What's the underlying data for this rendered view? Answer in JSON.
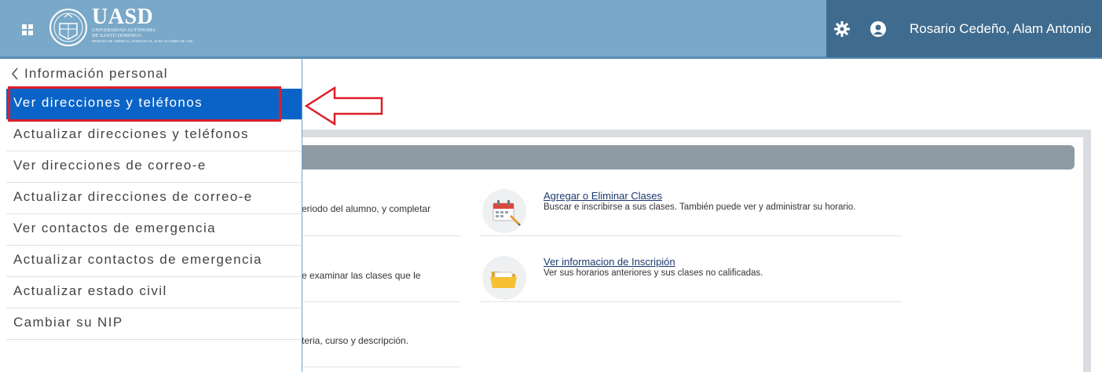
{
  "header": {
    "logo_abbr": "UASD",
    "logo_line1": "Universidad Autónoma",
    "logo_line2": "de Santo Domingo",
    "logo_line3": "Primada de América | Fundada el 28 de octubre de 1538",
    "user_name": "Rosario Cedeño, Alam Antonio",
    "icons": [
      "apps-grid-icon",
      "gear-icon",
      "user-icon"
    ]
  },
  "sidemenu": {
    "back_label": "Información personal",
    "items": [
      {
        "label": "Ver direcciones y teléfonos",
        "active": true
      },
      {
        "label": "Actualizar direcciones y teléfonos"
      },
      {
        "label": "Ver direcciones de correo-e"
      },
      {
        "label": "Actualizar direcciones de correo-e"
      },
      {
        "label": "Ver contactos de emergencia"
      },
      {
        "label": "Actualizar contactos de emergencia"
      },
      {
        "label": "Actualizar estado civil"
      },
      {
        "label": "Cambiar su NIP"
      }
    ]
  },
  "content": {
    "left_fragments": [
      "eriodo del alumno, y completar",
      "e examinar las clases que le",
      "teria, curso y descripción."
    ],
    "cards": [
      {
        "title": "Agregar o Eliminar Clases",
        "desc": "Buscar e inscribirse a sus clases. También puede ver y administrar su horario.",
        "icon": "calendar-icon"
      },
      {
        "title": "Ver informacion de Inscripión",
        "desc": "Ver sus horarios anteriores y sus clases no calificadas.",
        "icon": "folder-icon"
      }
    ]
  },
  "colors": {
    "header": "#79a8c8",
    "user_area": "#3f6b8e",
    "active_item": "#0a64c7",
    "highlight": "#dd1e2a"
  }
}
